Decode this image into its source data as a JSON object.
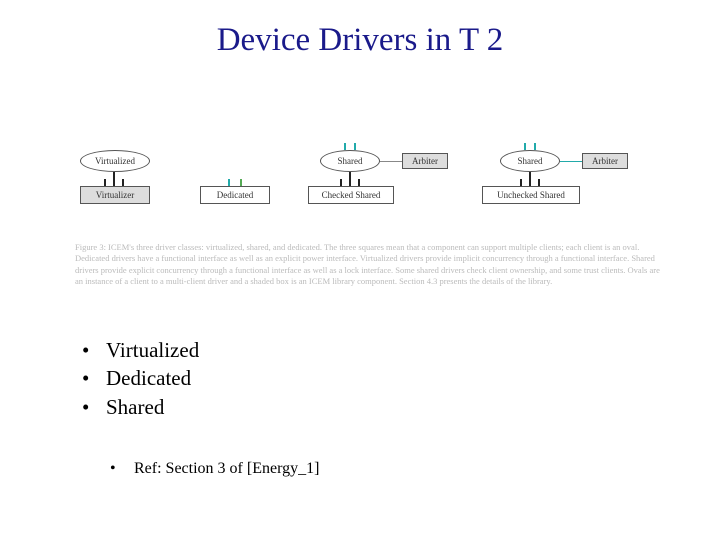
{
  "title": "Device Drivers in T 2",
  "figure": {
    "group1": {
      "oval": "Virtualized",
      "box": "Virtualizer"
    },
    "group2": {
      "box": "Dedicated"
    },
    "group3": {
      "oval": "Shared",
      "arbiter": "Arbiter",
      "box": "Checked Shared"
    },
    "group4": {
      "oval": "Shared",
      "arbiter": "Arbiter",
      "box": "Unchecked Shared"
    }
  },
  "caption": "Figure 3: ICEM's three driver classes: virtualized, shared, and dedicated. The three squares mean that a component can support multiple clients; each client is an oval. Dedicated drivers have a functional interface as well as an explicit power interface. Virtualized drivers provide implicit concurrency through a functional interface. Shared drivers provide explicit concurrency through a functional interface as well as a lock interface. Some shared drivers check client ownership, and some trust clients. Ovals are an instance of a client to a multi-client driver and a shaded box is an ICEM library component. Section 4.3 presents the details of the library.",
  "bullets": {
    "b1": "Virtualized",
    "b2": "Dedicated",
    "b3": "Shared"
  },
  "subbullet": "Ref: Section 3 of [Energy_1]"
}
